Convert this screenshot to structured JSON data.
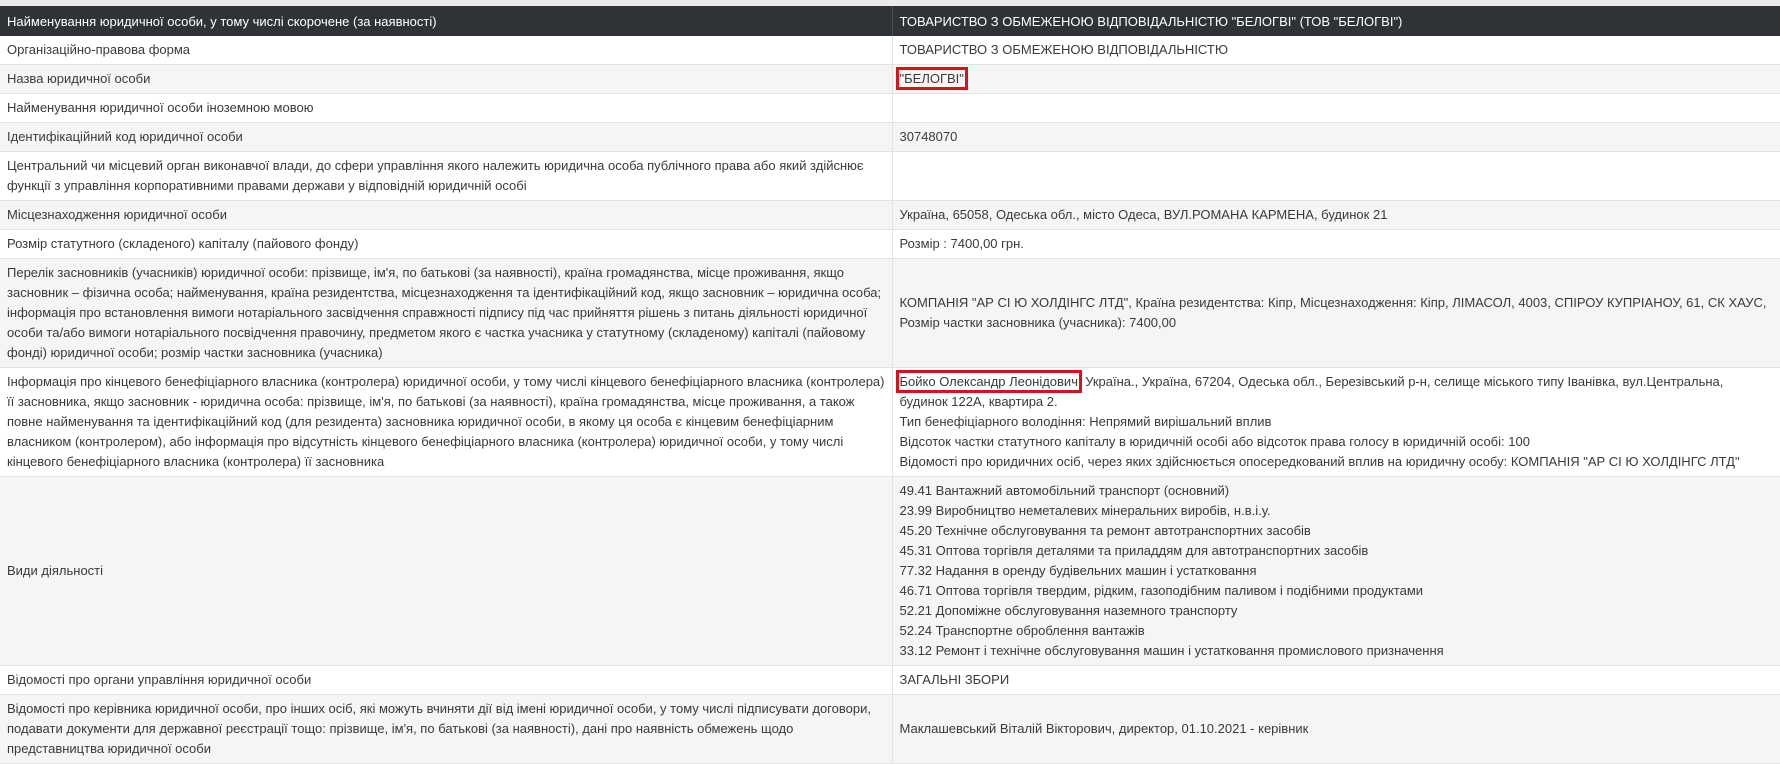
{
  "header": {
    "left": "Найменування юридичної особи, у тому числі скорочене (за наявності)",
    "right": "ТОВАРИСТВО З ОБМЕЖЕНОЮ ВІДПОВІДАЛЬНІСТЮ \"БЕЛОГВІ\" (ТОВ \"БЕЛОГВІ\")"
  },
  "rows": {
    "org_form": {
      "label": "Організаційно-правова форма",
      "value": "ТОВАРИСТВО З ОБМЕЖЕНОЮ ВІДПОВІДАЛЬНІСТЮ"
    },
    "name": {
      "label": "Назва юридичної особи",
      "value": "\"БЕЛОГВІ\""
    },
    "foreign_name": {
      "label": "Найменування юридичної особи іноземною мовою",
      "value": ""
    },
    "code": {
      "label": "Ідентифікаційний код юридичної особи",
      "value": "30748070"
    },
    "central_body": {
      "label": "Центральний чи місцевий орган виконавчої влади, до сфери управління якого належить юридична особа публічного права або який здійснює функції з управління корпоративними правами держави у відповідній юридичній особі",
      "value": ""
    },
    "location": {
      "label": "Місцезнаходження юридичної особи",
      "value": "Україна, 65058, Одеська обл., місто Одеса, ВУЛ.РОМАНА КАРМЕНА, будинок 21"
    },
    "capital": {
      "label": "Розмір статутного (складеного) капіталу (пайового фонду)",
      "value": "Розмір : 7400,00 грн."
    },
    "founders": {
      "label": "Перелік засновників (учасників) юридичної особи: прізвище, ім'я, по батькові (за наявності), країна громадянства, місце проживання, якщо засновник – фізична особа; найменування, країна резидентства, місцезнаходження та ідентифікаційний код, якщо засновник – юридична особа; інформація про встановлення вимоги нотаріального засвідчення справжності підпису під час прийняття рішень з питань діяльності юридичної особи та/або вимоги нотаріального посвідчення правочину, предметом якого є частка учасника у статутному (складеному) капіталі (пайовому фонді) юридичної особи; розмір частки засновника (учасника)",
      "value": "КОМПАНІЯ \"АР СІ Ю ХОЛДІНГС ЛТД\", Країна резидентства: Кіпр, Місцезнаходження: Кіпр, ЛІМАСОЛ, 4003, СПІРОУ КУПРІАНОУ, 61, СК ХАУС, Розмір частки засновника (учасника): 7400,00"
    },
    "beneficiary": {
      "label": "Інформація про кінцевого бенефіціарного власника (контролера) юридичної особи, у тому числі кінцевого бенефіціарного власника (контролера) її засновника, якщо засновник - юридична особа: прізвище, ім'я, по батькові (за наявності), країна громадянства, місце проживання, а також повне найменування та ідентифікаційний код (для резидента) засновника юридичної особи, в якому ця особа є кінцевим бенефіціарним власником (контролером), або інформація про відсутність кінцевого бенефіціарного власника (контролера) юридичної особи, у тому числі кінцевого бенефіціарного власника (контролера) її засновника",
      "person": "Бойко Олександр Леонідович",
      "address": ", Україна., Україна, 67204, Одеська обл., Березівський р-н, селище міського типу Іванівка, вул.Центральна, будинок 122А, квартира 2.",
      "type": "Тип бенефіціарного володіння: Непрямий вирішальний вплив",
      "share": "Відсоток частки статутного капіталу в юридичній особі або відсоток права голосу в юридичній особі: 100",
      "via": "Відомості про юридичних осіб, через яких здійснюється опосередкований вплив на юридичну особу: КОМПАНІЯ \"АР СІ Ю ХОЛДІНГС ЛТД\""
    },
    "activities": {
      "label": "Види діяльності",
      "items": [
        "49.41 Вантажний автомобільний транспорт (основний)",
        "23.99 Виробництво неметалевих мінеральних виробів, н.в.і.у.",
        "45.20 Технічне обслуговування та ремонт автотранспортних засобів",
        "45.31 Оптова торгівля деталями та приладдям для автотранспортних засобів",
        "77.32 Надання в оренду будівельних машин і устатковання",
        "46.71 Оптова торгівля твердим, рідким, газоподібним паливом і подібними продуктами",
        "52.21 Допоміжне обслуговування наземного транспорту",
        "52.24 Транспортне оброблення вантажів",
        "33.12 Ремонт і технічне обслуговування машин і устатковання промислового призначення"
      ]
    },
    "governance": {
      "label": "Відомості про органи управління юридичної особи",
      "value": "ЗАГАЛЬНІ ЗБОРИ"
    },
    "director": {
      "label": "Відомості про керівника юридичної особи, про інших осіб, які можуть вчиняти дії від імені юридичної особи, у тому числі підписувати договори, подавати документи для державної реєстрації тощо: прізвище, ім'я, по батькові (за наявності), дані про наявність обмежень щодо представництва юридичної особи",
      "value": "Маклашевський Віталій Вікторович, директор, 01.10.2021 - керівник"
    }
  },
  "colors": {
    "header_bg": "#2f3337",
    "row_alt_bg": "#f5f5f5",
    "highlight": "#d4141c"
  }
}
